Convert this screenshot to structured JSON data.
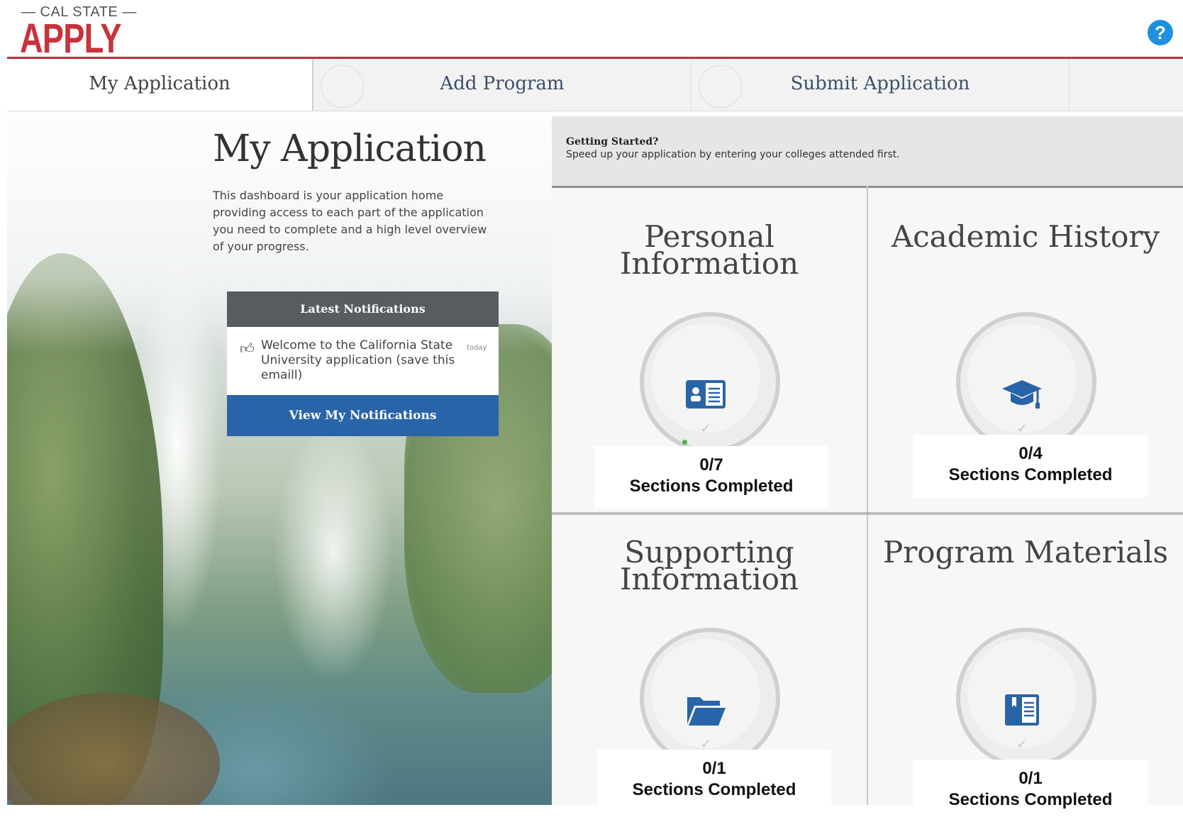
{
  "header": {
    "logo_small": "— CAL STATE —",
    "logo_main": "APPLY",
    "help_icon": "?",
    "colors": {
      "brand_red": "#c8323c",
      "help_blue": "#1f8fe0"
    }
  },
  "nav": {
    "tabs": [
      {
        "label": "My Application",
        "active": true
      },
      {
        "label": "Add Program",
        "active": false
      },
      {
        "label": "Submit Application",
        "active": false
      }
    ]
  },
  "main": {
    "title": "My Application",
    "intro": "This dashboard is your application home providing access to each part of the application you need to complete and a high level overview of your progress."
  },
  "notifications": {
    "header": "Latest Notifications",
    "items": [
      {
        "text": "Welcome to the California State University application (save this emaill)",
        "time": "today",
        "icon": "thumbs-up-icon"
      }
    ],
    "button_label": "View My Notifications",
    "button_color": "#2a64a8"
  },
  "getting_started": {
    "title": "Getting Started?",
    "text": "Speed up your application by entering your colleges attended first."
  },
  "tiles": [
    {
      "title": "Personal Information",
      "icon": "id-card-icon",
      "progress": "0/7",
      "status": "Sections Completed"
    },
    {
      "title": "Academic History",
      "icon": "graduation-cap-icon",
      "progress": "0/4",
      "status": "Sections Completed"
    },
    {
      "title": "Supporting Information",
      "icon": "folder-icon",
      "progress": "0/1",
      "status": "Sections Completed"
    },
    {
      "title": "Program Materials",
      "icon": "open-book-icon",
      "progress": "0/1",
      "status": "Sections Completed"
    }
  ]
}
